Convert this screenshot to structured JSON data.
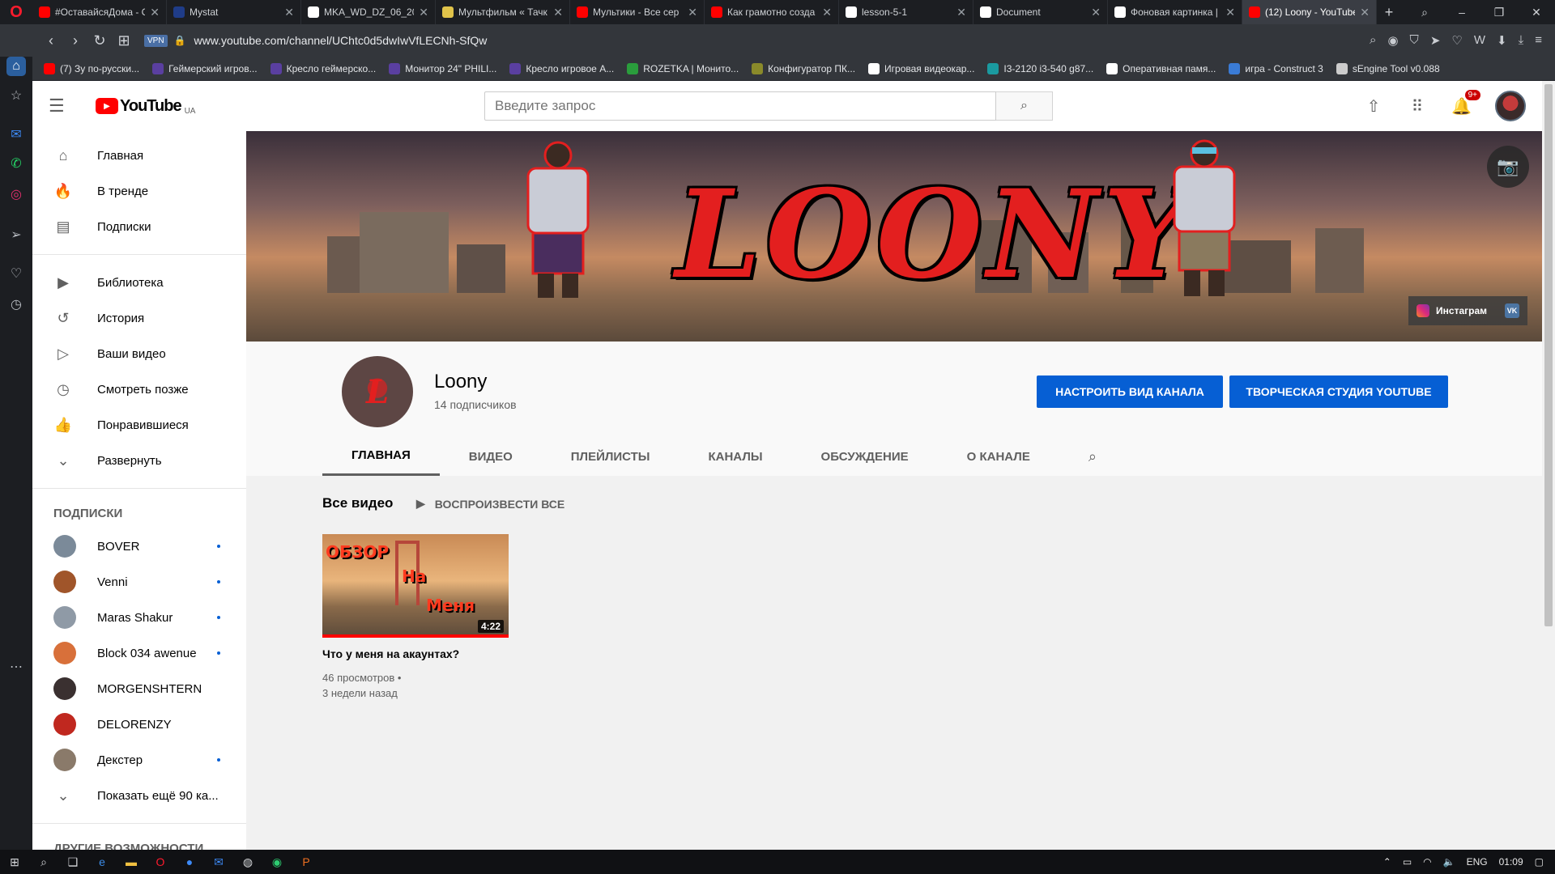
{
  "browser": {
    "tabs": [
      {
        "title": "#ОставайсяДома - С",
        "color": "#ff0000"
      },
      {
        "title": "Mystat",
        "color": "#1f3c88"
      },
      {
        "title": "MKA_WD_DZ_06_20",
        "color": "#ffffff"
      },
      {
        "title": "Мультфильм « Тачк",
        "color": "#e0c34a"
      },
      {
        "title": "Мультики - Все сер",
        "color": "#ff0000"
      },
      {
        "title": "Как грамотно созда",
        "color": "#ff0000"
      },
      {
        "title": "lesson-5-1",
        "color": "#ffffff"
      },
      {
        "title": "Document",
        "color": "#ffffff"
      },
      {
        "title": "Фоновая картинка |",
        "color": "#ffffff"
      },
      {
        "title": "(12) Loony - YouTube",
        "color": "#ff0000",
        "active": true
      }
    ],
    "new_tab": "+",
    "url": "www.youtube.com/channel/UChtc0d5dwIwVfLECNh-SfQw",
    "vpn": "VPN",
    "bookmarks": [
      {
        "label": "(7) Зу по-русски...",
        "color": "#ff0000"
      },
      {
        "label": "Геймерский игров...",
        "color": "#5a3fa0"
      },
      {
        "label": "Кресло геймерско...",
        "color": "#5a3fa0"
      },
      {
        "label": "Монитор 24\" PHILI...",
        "color": "#5a3fa0"
      },
      {
        "label": "Кресло игровое A...",
        "color": "#5a3fa0"
      },
      {
        "label": "ROZETKA | Монито...",
        "color": "#2a9d3c"
      },
      {
        "label": "Конфигуратор ПК...",
        "color": "#8a8a2a"
      },
      {
        "label": "Игровая видеокар...",
        "color": "#ffffff"
      },
      {
        "label": "I3-2120 i3-540 g87...",
        "color": "#1a9aa0"
      },
      {
        "label": "Оперативная памя...",
        "color": "#ffffff"
      },
      {
        "label": "игра - Construct 3",
        "color": "#3a7bd5"
      },
      {
        "label": "sEngine Tool v0.088",
        "color": "#cccccc"
      }
    ]
  },
  "header": {
    "logo_text": "YouTube",
    "country": "UA",
    "search_placeholder": "Введите запрос",
    "notification_count": "9+"
  },
  "sidebar": {
    "main": [
      {
        "label": "Главная",
        "icon": "home-icon"
      },
      {
        "label": "В тренде",
        "icon": "trending-icon"
      },
      {
        "label": "Подписки",
        "icon": "subscriptions-icon"
      }
    ],
    "library": [
      {
        "label": "Библиотека",
        "icon": "library-icon"
      },
      {
        "label": "История",
        "icon": "history-icon"
      },
      {
        "label": "Ваши видео",
        "icon": "your-videos-icon"
      },
      {
        "label": "Смотреть позже",
        "icon": "watch-later-icon"
      },
      {
        "label": "Понравившиеся",
        "icon": "liked-icon"
      },
      {
        "label": "Развернуть",
        "icon": "chevron-down-icon"
      }
    ],
    "subscriptions_heading": "ПОДПИСКИ",
    "subscriptions": [
      {
        "name": "BOVER",
        "color": "#7b8a99",
        "new": true
      },
      {
        "name": "Venni",
        "color": "#a0552a",
        "new": true
      },
      {
        "name": "Maras Shakur",
        "color": "#8f9aa6",
        "new": true
      },
      {
        "name": "Block 034 awenue",
        "color": "#d8703a",
        "new": true
      },
      {
        "name": "MORGENSHTERN",
        "color": "#3a3030",
        "new": false
      },
      {
        "name": "DELORENZY",
        "color": "#c0281f",
        "new": false
      },
      {
        "name": "Декстер",
        "color": "#8a7a6a",
        "new": true
      }
    ],
    "show_more": "Показать ещё 90 ка...",
    "other_heading": "ДРУГИЕ ВОЗМОЖНОСТИ"
  },
  "banner": {
    "title": "LOONY",
    "social_label": "Инстаграм",
    "vk_label": "VK"
  },
  "channel": {
    "avatar_letter": "L",
    "name": "Loony",
    "subscribers": "14 подписчиков",
    "customize_button": "НАСТРОИТЬ ВИД КАНАЛА",
    "studio_button": "ТВОРЧЕСКАЯ СТУДИЯ YOUTUBE",
    "tabs": [
      "ГЛАВНАЯ",
      "ВИДЕО",
      "ПЛЕЙЛИСТЫ",
      "КАНАЛЫ",
      "ОБСУЖДЕНИЕ",
      "О КАНАЛЕ"
    ]
  },
  "content": {
    "section_title": "Все видео",
    "play_all": "ВОСПРОИЗВЕСТИ ВСЕ",
    "video": {
      "thumb_text_1": "ОБЗОР",
      "thumb_text_2": "На",
      "thumb_text_3": "Меня",
      "duration": "4:22",
      "title": "Что у меня на акаунтах?",
      "views": "46 просмотров •",
      "age": "3 недели назад"
    }
  },
  "taskbar": {
    "lang": "ENG",
    "time": "01:09"
  }
}
